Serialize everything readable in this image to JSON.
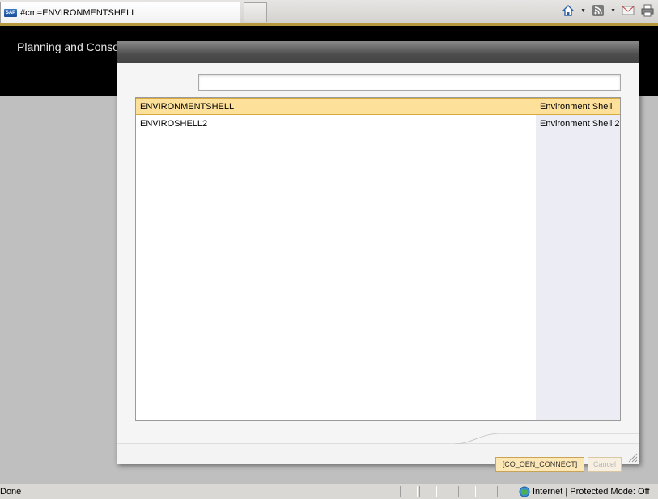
{
  "browser": {
    "tab_title": "#cm=ENVIRONMENTSHELL",
    "favicon_text": "SAP",
    "icons": [
      "home-icon",
      "feeds-icon",
      "read-mail-icon",
      "print-icon"
    ]
  },
  "app": {
    "title": "Planning and Consolidation"
  },
  "dialog": {
    "search": {
      "value": "",
      "placeholder": ""
    },
    "rows": [
      {
        "name": "ENVIRONMENTSHELL",
        "description": "Environment Shell",
        "selected": true
      },
      {
        "name": "ENVIROSHELL2",
        "description": "Environment Shell 2",
        "selected": false
      }
    ],
    "ok_label": "[CO_OEN_CONNECT]",
    "cancel_label": "Cancel"
  },
  "status": {
    "text": "Done",
    "zone": "Internet | Protected Mode: Off"
  },
  "colors": {
    "selected_row": "#fde19b",
    "header_bg": "#000000",
    "accent_line": "#b89a3e"
  }
}
